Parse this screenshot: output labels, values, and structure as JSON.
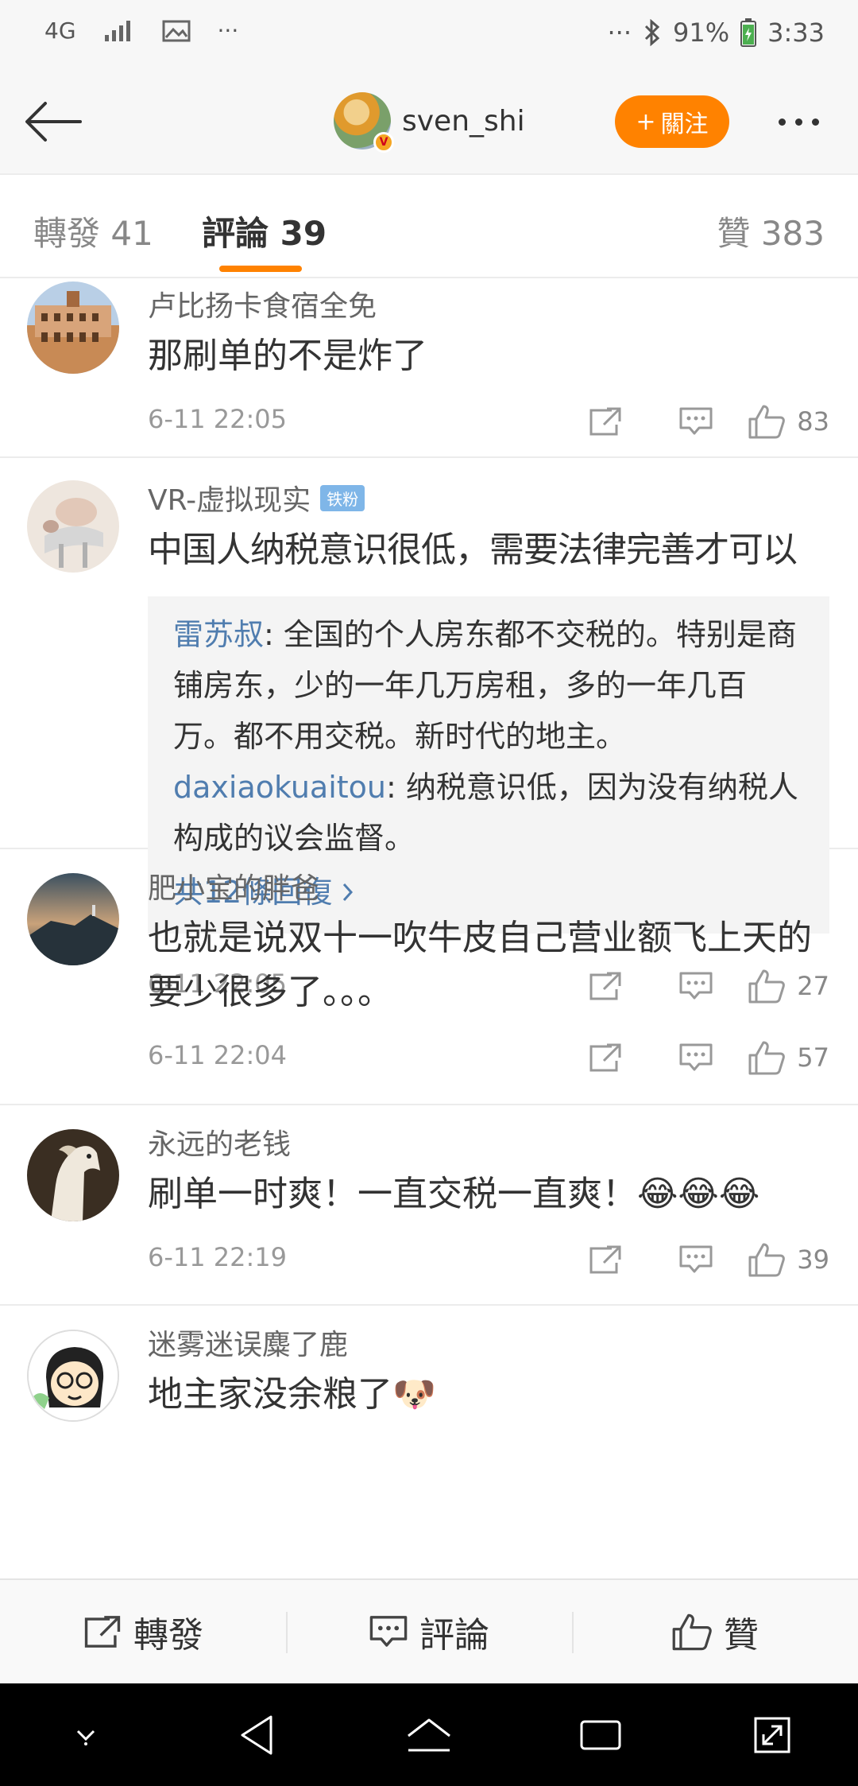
{
  "status_bar": {
    "network": "4G",
    "battery": "91%",
    "time": "3:33",
    "more_left": "···",
    "more_right": "···"
  },
  "header": {
    "username": "sven_shi",
    "follow_label": "關注",
    "follow_plus": "+"
  },
  "tabs": [
    {
      "label": "轉發 41"
    },
    {
      "label": "評論 39"
    },
    {
      "label": "贊 383"
    }
  ],
  "comments": [
    {
      "author": "卢比扬卡食宿全免",
      "text": "那刷单的不是炸了",
      "time": "6-11 22:05",
      "likes": "83"
    },
    {
      "author": "VR-虚拟现实",
      "badge": "铁粉",
      "text": "中国人纳税意识很低，需要法律完善才可以",
      "time": "6-11 22:05",
      "likes": "27",
      "replies": [
        {
          "author": "雷苏叔",
          "text": ": 全国的个人房东都不交税的。特别是商铺房东，少的一年几万房租，多的一年几百万。都不用交税。新时代的地主。"
        },
        {
          "author": "daxiaokuaitou",
          "text": ": 纳税意识低，因为没有纳税人构成的议会监督。"
        }
      ],
      "more_replies": "共12條回復"
    },
    {
      "author": "肥小宝的胖爸",
      "text": "也就是说双十一吹牛皮自己营业额飞上天的要少很多了。。。",
      "time": "6-11 22:04",
      "likes": "57"
    },
    {
      "author": "永远的老钱",
      "text": "刷单一时爽！一直交税一直爽！😂😂😂",
      "time": "6-11 22:19",
      "likes": "39"
    },
    {
      "author": "迷雾迷误麋了鹿",
      "text": "地主家没余粮了🐶",
      "time": "",
      "likes": ""
    }
  ],
  "bottom_bar": {
    "repost": "轉發",
    "comment": "評論",
    "like": "贊"
  },
  "colors": {
    "accent": "#ff8200",
    "link": "#507daf",
    "badge": "#7fb6e8"
  }
}
